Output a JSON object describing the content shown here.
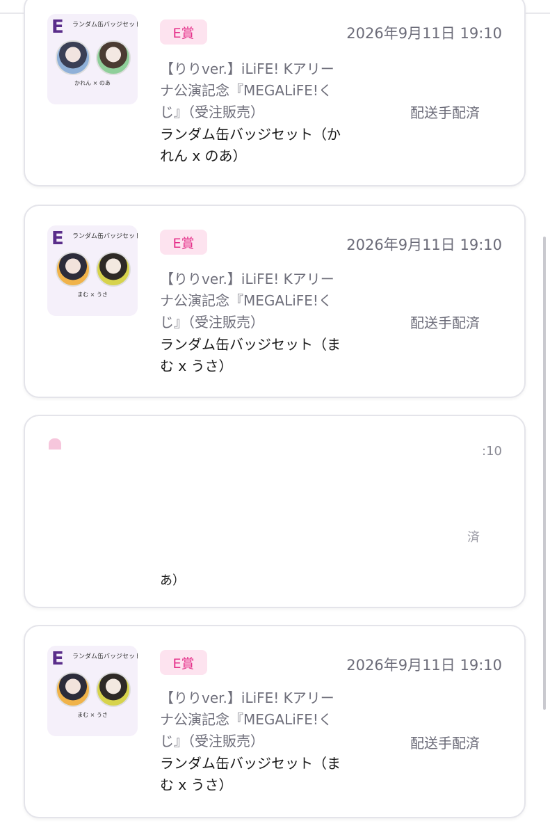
{
  "cards": [
    {
      "prize": "E賞",
      "date": "2026年9月11日 19:10",
      "desc_lines": [
        "【りりver.】iLiFE! Kアリー",
        "ナ公演記念『MEGALiFE!く",
        "じ』（受注販売）"
      ],
      "name_lines": [
        "ランダム缶バッジセット（か",
        "れん x のあ）"
      ],
      "status": "配送手配済",
      "thumb": {
        "letter": "E",
        "title": "ランダム缶バッジセット",
        "names": "かれん × のあ"
      }
    },
    {
      "prize": "E賞",
      "date": "2026年9月11日 19:10",
      "desc_lines": [
        "【りりver.】iLiFE! Kアリー",
        "ナ公演記念『MEGALiFE!く",
        "じ』（受注販売）"
      ],
      "name_lines": [
        "ランダム缶バッジセット（ま",
        "む x うさ）"
      ],
      "status": "配送手配済",
      "thumb": {
        "letter": "E",
        "title": "ランダム缶バッジセット",
        "names": "まむ × うさ"
      }
    },
    {
      "fragments": {
        "date_tail": ":10",
        "status_tail": "済",
        "name_tail": "あ）"
      }
    },
    {
      "prize": "E賞",
      "date": "2026年9月11日 19:10",
      "desc_lines": [
        "【りりver.】iLiFE! Kアリー",
        "ナ公演記念『MEGALiFE!く",
        "じ』（受注販売）"
      ],
      "name_lines": [
        "ランダム缶バッジセット（ま",
        "む x うさ）"
      ],
      "status": "配送手配済",
      "thumb": {
        "letter": "E",
        "title": "ランダム缶バッジセット",
        "names": "まむ × うさ"
      }
    }
  ],
  "colors": {
    "prize_bg": "#fde3ef",
    "prize_text": "#e5308a",
    "thumb_letter": "#5a2d8a"
  }
}
